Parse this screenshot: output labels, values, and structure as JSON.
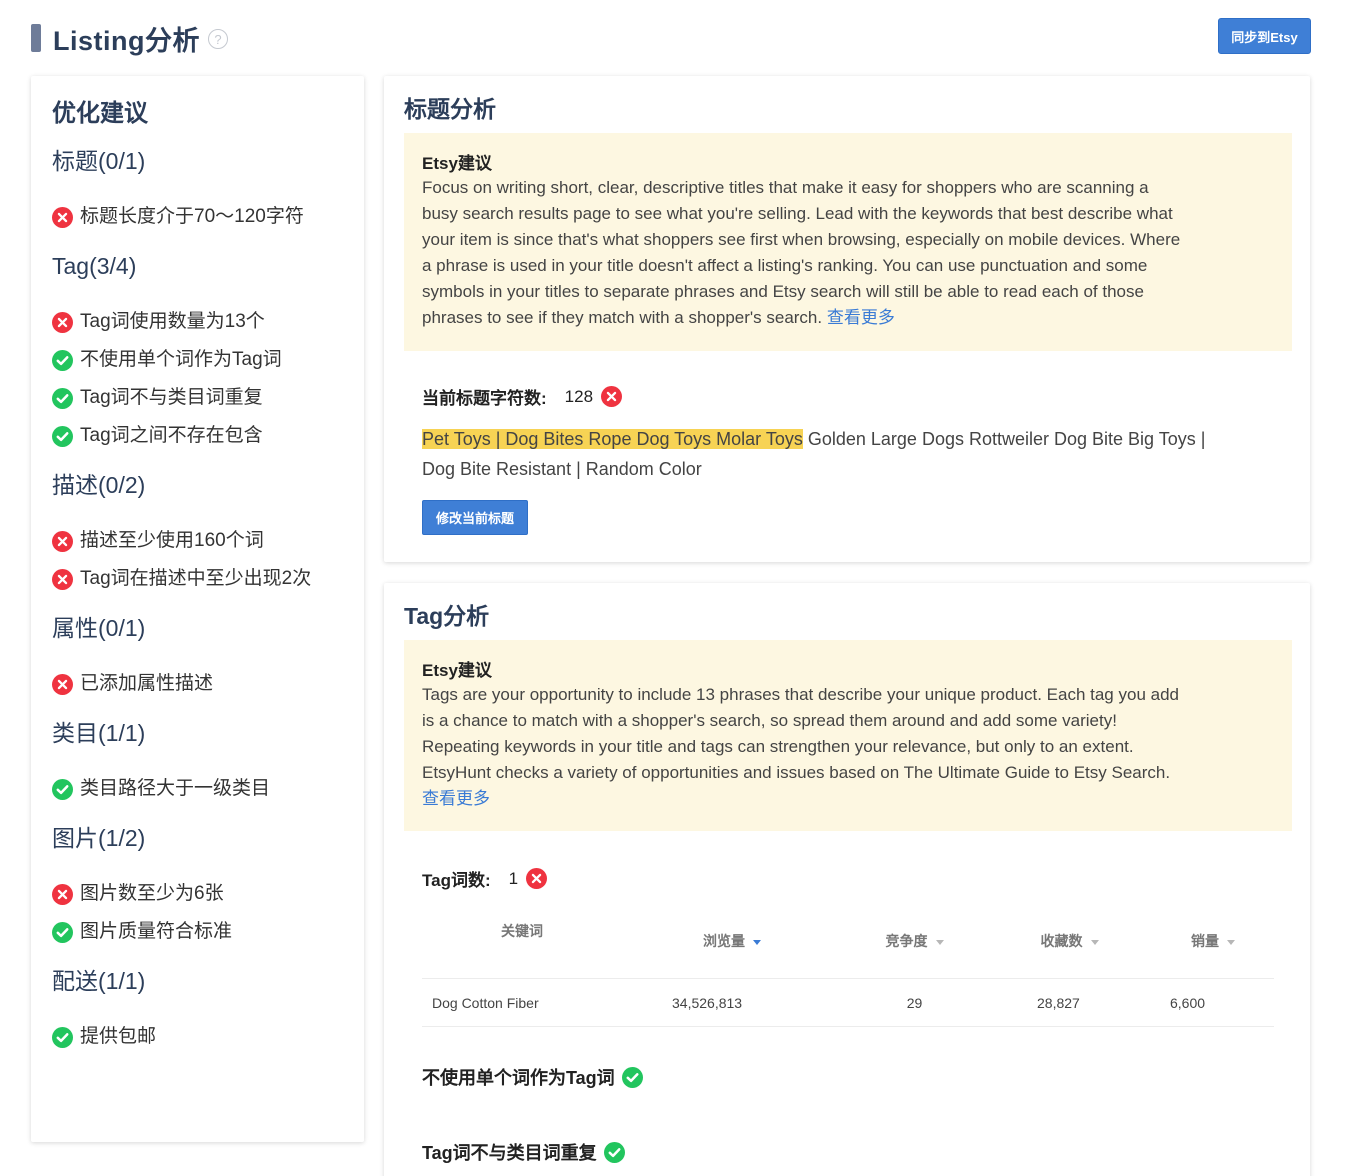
{
  "header": {
    "title": "Listing分析",
    "help_icon": "?",
    "sync_button": "同步到Etsy"
  },
  "sidebar": {
    "title": "优化建议",
    "sections": [
      {
        "heading": "标题(0/1)",
        "rules": [
          {
            "status": "fail",
            "text": "标题长度介于70～120字符"
          }
        ]
      },
      {
        "heading": "Tag(3/4)",
        "rules": [
          {
            "status": "fail",
            "text": "Tag词使用数量为13个"
          },
          {
            "status": "pass",
            "text": "不使用单个词作为Tag词"
          },
          {
            "status": "pass",
            "text": "Tag词不与类目词重复"
          },
          {
            "status": "pass",
            "text": "Tag词之间不存在包含"
          }
        ]
      },
      {
        "heading": "描述(0/2)",
        "rules": [
          {
            "status": "fail",
            "text": "描述至少使用160个词"
          },
          {
            "status": "fail",
            "text": "Tag词在描述中至少出现2次"
          }
        ]
      },
      {
        "heading": "属性(0/1)",
        "rules": [
          {
            "status": "fail",
            "text": "已添加属性描述"
          }
        ]
      },
      {
        "heading": "类目(1/1)",
        "rules": [
          {
            "status": "pass",
            "text": "类目路径大于一级类目"
          }
        ]
      },
      {
        "heading": "图片(1/2)",
        "rules": [
          {
            "status": "fail",
            "text": "图片数至少为6张"
          },
          {
            "status": "pass",
            "text": "图片质量符合标准"
          }
        ]
      },
      {
        "heading": "配送(1/1)",
        "rules": [
          {
            "status": "pass",
            "text": "提供包邮"
          }
        ]
      }
    ]
  },
  "title_analysis": {
    "title": "标题分析",
    "advice_label": "Etsy建议",
    "advice_lines": [
      "Focus on writing short, clear, descriptive titles that make it easy for shoppers who are scanning a",
      "busy search results page to see what you're selling. Lead with the keywords that best describe what",
      "your item is since that's what shoppers see first when browsing, especially on mobile devices. Where",
      "a phrase is used in your title doesn't affect a listing's ranking. You can use punctuation and some",
      "symbols in your titles to separate phrases and Etsy search will still be able to read each of those",
      "phrases to see if they match with a shopper's search."
    ],
    "more_link": "查看更多",
    "char_count_label": "当前标题字符数:",
    "char_count_value": "128",
    "char_count_status": "fail",
    "current_title_highlight": "Pet Toys | Dog Bites Rope Dog Toys Molar Toys",
    "current_title_line1_rest": " Golden Large Dogs Rottweiler Dog Bite Big Toys |",
    "current_title_line2": "Dog Bite Resistant | Random Color",
    "edit_button": "修改当前标题"
  },
  "tag_analysis": {
    "title": "Tag分析",
    "advice_label": "Etsy建议",
    "advice_lines": [
      "Tags are your opportunity to include 13 phrases that describe your unique product. Each tag you add",
      "is a chance to match with a shopper's search, so spread them around and add some variety!",
      "Repeating keywords in your title and tags can strengthen your relevance, but only to an extent.",
      "EtsyHunt checks a variety of opportunities and issues based on The Ultimate Guide to Etsy Search."
    ],
    "more_link": "查看更多",
    "count_label": "Tag词数:",
    "count_value": "1",
    "count_status": "fail",
    "table": {
      "columns": [
        "关键词",
        "浏览量",
        "竞争度",
        "收藏数",
        "销量"
      ],
      "sorted_column": "浏览量",
      "rows": [
        {
          "keyword": "Dog Cotton Fiber",
          "views": "34,526,813",
          "competition": "29",
          "favorites": "28,827",
          "sales": "6,600"
        }
      ]
    },
    "checks": [
      {
        "label": "不使用单个词作为Tag词",
        "status": "pass"
      },
      {
        "label": "Tag词不与类目词重复",
        "status": "pass"
      }
    ]
  },
  "colors": {
    "accent": "#3f7fd6",
    "pass": "#22c55e",
    "fail": "#ef3340",
    "advice_bg": "#fdf7e1",
    "highlight": "#f7d354",
    "heading": "#2c3e5a"
  },
  "icons": {
    "pass": "check-circle-icon",
    "fail": "x-circle-icon",
    "help": "question-circle-icon",
    "sort": "caret-down-icon"
  }
}
